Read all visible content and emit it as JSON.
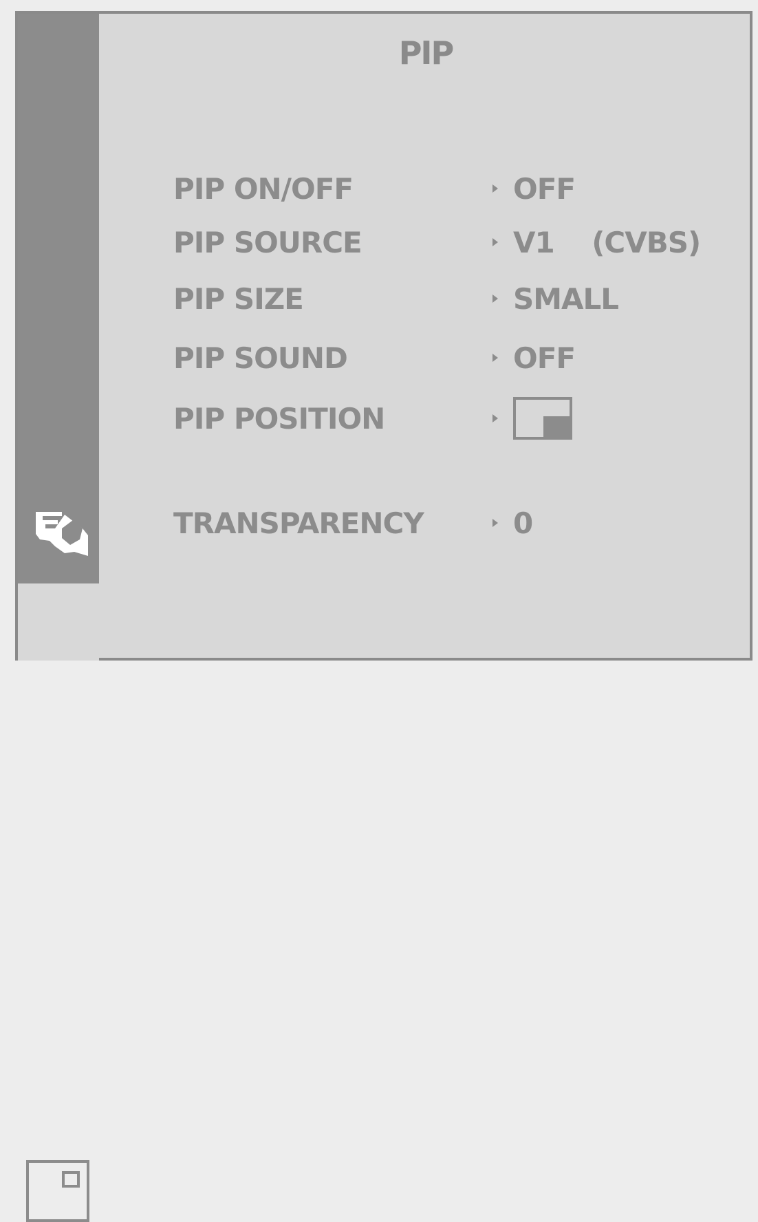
{
  "menu": {
    "title": "PIP",
    "items": [
      {
        "label": "PIP ON/OFF",
        "value": "OFF"
      },
      {
        "label": "PIP SOURCE",
        "value": "V1    (CVBS)"
      },
      {
        "label": "PIP SIZE",
        "value": "SMALL"
      },
      {
        "label": "PIP SOUND",
        "value": "OFF"
      },
      {
        "label": "PIP POSITION",
        "value_icon": "pip-position-bottom-right-icon"
      },
      {
        "label": "TRANSPARENCY",
        "value": "0"
      }
    ]
  },
  "sidebar": {
    "icons": [
      "hand-pointer-icon",
      "pip-window-icon"
    ]
  },
  "colors": {
    "background": "#d8d8d8",
    "text": "#8c8c8c",
    "sidebar": "#8c8c8c"
  }
}
